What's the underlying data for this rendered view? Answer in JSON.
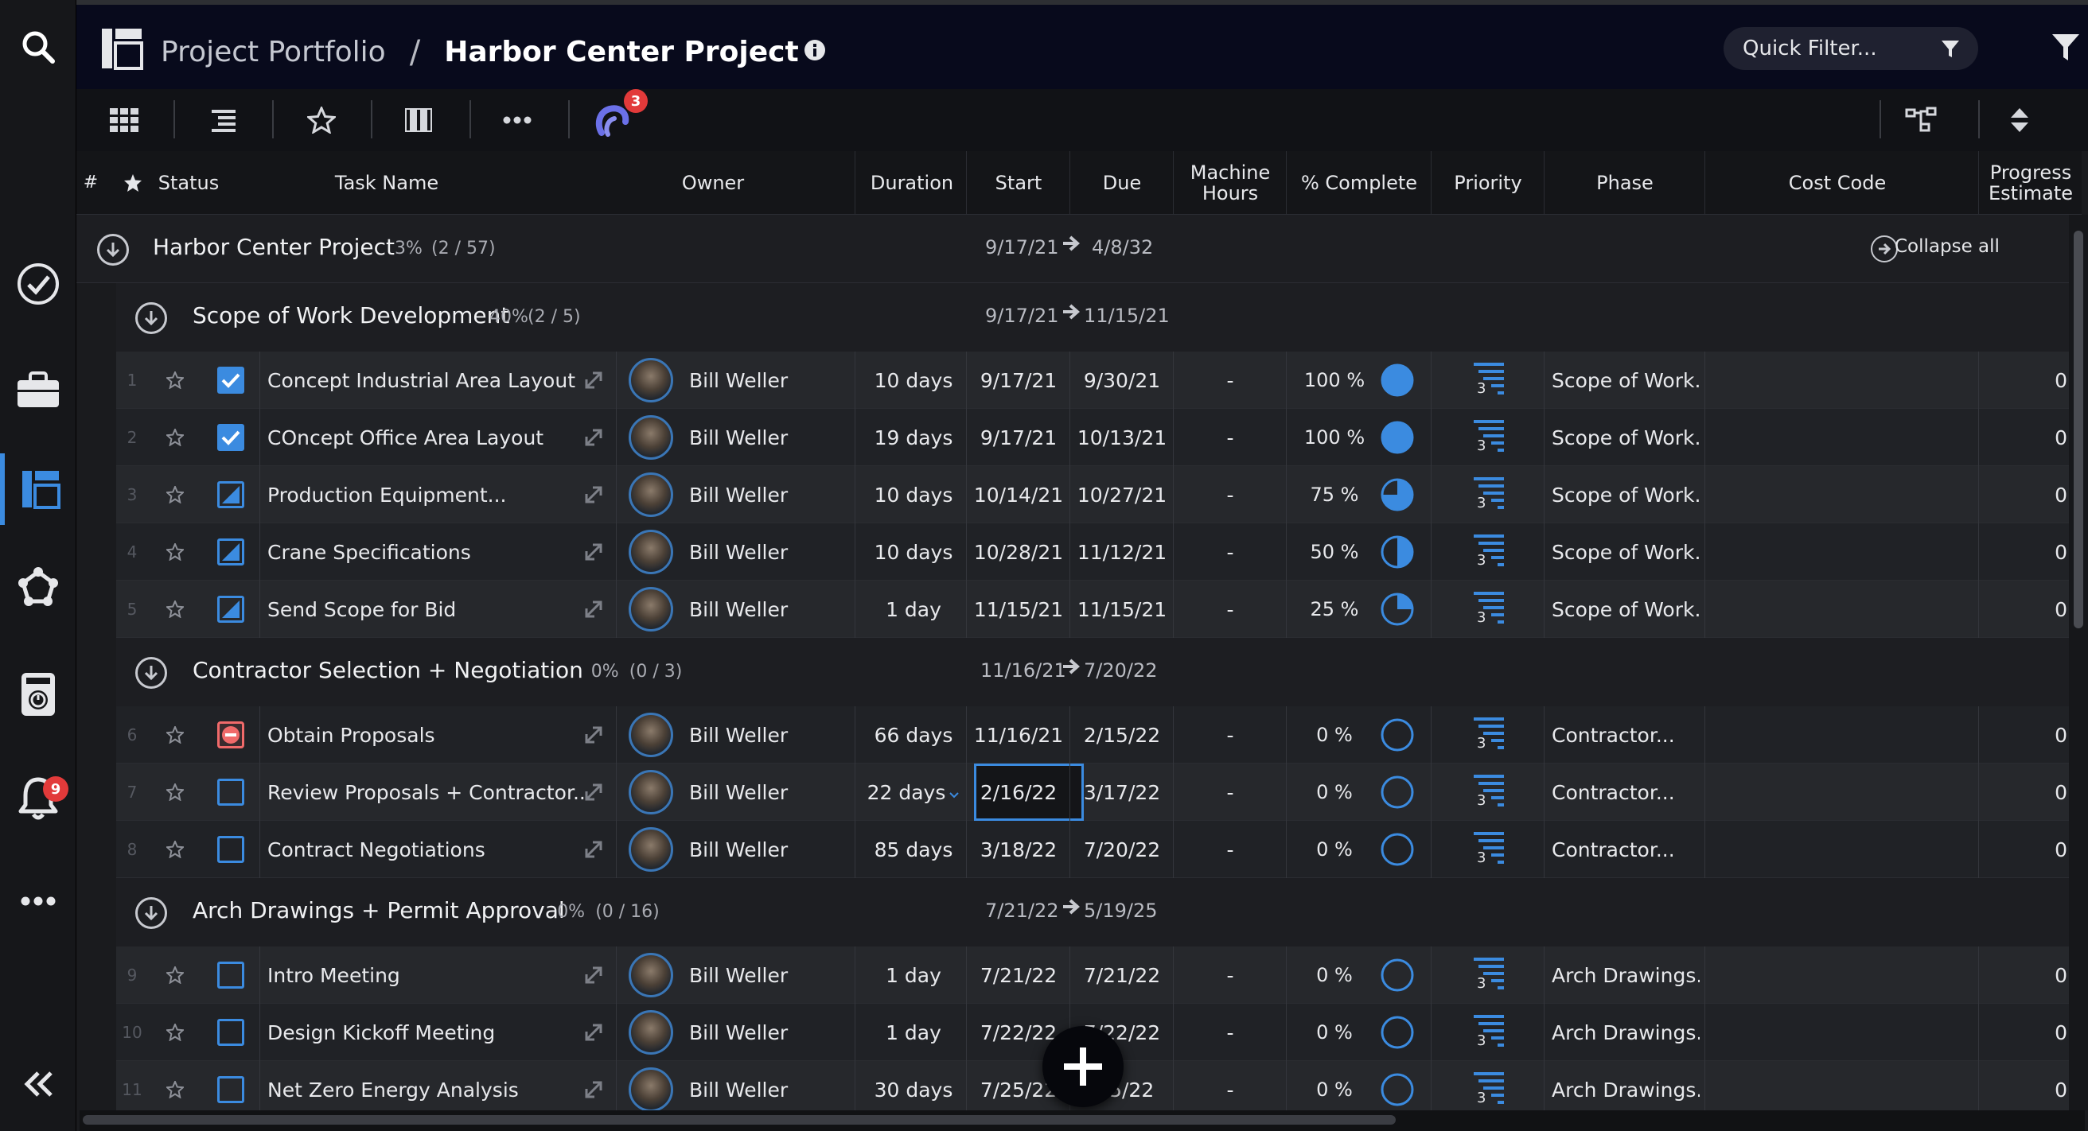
{
  "breadcrumb": {
    "portfolio": "Project Portfolio",
    "separator": "/",
    "project": "Harbor Center Project"
  },
  "quick_filter": {
    "placeholder": "Quick Filter..."
  },
  "toolbar": {
    "comments_badge": "3"
  },
  "sidebar": {
    "notifications_badge": "9"
  },
  "columns": [
    "#",
    "Status",
    "Task Name",
    "Owner",
    "Duration",
    "Start",
    "Due",
    "Machine Hours",
    "% Complete",
    "Priority",
    "Phase",
    "Cost Code",
    "Progress Estimate"
  ],
  "project_row": {
    "name": "Harbor Center Project",
    "pct": "3%",
    "count": "(2 / 57)",
    "start": "9/17/21",
    "due": "4/8/32",
    "collapse_label": "Collapse all"
  },
  "groups": [
    {
      "name": "Scope of Work Development",
      "pct": "40%",
      "count": "(2 / 5)",
      "start": "9/17/21",
      "due": "11/15/21"
    },
    {
      "name": "Contractor Selection + Negotiation",
      "pct": "0%",
      "count": "(0 / 3)",
      "start": "11/16/21",
      "due": "7/20/22"
    },
    {
      "name": "Arch Drawings + Permit Approval",
      "pct": "0%",
      "count": "(0 / 16)",
      "start": "7/21/22",
      "due": "5/19/25"
    }
  ],
  "tasks": [
    {
      "num": "1",
      "status": "complete",
      "name": "Concept Industrial Area Layout",
      "owner": "Bill Weller",
      "duration": "10 days",
      "start": "9/17/21",
      "due": "9/30/21",
      "machine_hours": "-",
      "pct": "100 %",
      "pct_value": 100,
      "priority": "3",
      "phase": "Scope of Work...",
      "estimate": "0"
    },
    {
      "num": "2",
      "status": "complete",
      "name": "COncept Office Area Layout",
      "owner": "Bill Weller",
      "duration": "19 days",
      "start": "9/17/21",
      "due": "10/13/21",
      "machine_hours": "-",
      "pct": "100 %",
      "pct_value": 100,
      "priority": "3",
      "phase": "Scope of Work...",
      "estimate": "0"
    },
    {
      "num": "3",
      "status": "in-progress",
      "name": "Production Equipment...",
      "owner": "Bill Weller",
      "duration": "10 days",
      "start": "10/14/21",
      "due": "10/27/21",
      "machine_hours": "-",
      "pct": "75 %",
      "pct_value": 75,
      "priority": "3",
      "phase": "Scope of Work...",
      "estimate": "0"
    },
    {
      "num": "4",
      "status": "in-progress",
      "name": "Crane Specifications",
      "owner": "Bill Weller",
      "duration": "10 days",
      "start": "10/28/21",
      "due": "11/12/21",
      "machine_hours": "-",
      "pct": "50 %",
      "pct_value": 50,
      "priority": "3",
      "phase": "Scope of Work...",
      "estimate": "0"
    },
    {
      "num": "5",
      "status": "in-progress",
      "name": "Send Scope for Bid",
      "owner": "Bill Weller",
      "duration": "1 day",
      "start": "11/15/21",
      "due": "11/15/21",
      "machine_hours": "-",
      "pct": "25 %",
      "pct_value": 25,
      "priority": "3",
      "phase": "Scope of Work...",
      "estimate": "0"
    },
    {
      "num": "6",
      "status": "blocked",
      "name": "Obtain Proposals",
      "owner": "Bill Weller",
      "duration": "66 days",
      "start": "11/16/21",
      "due": "2/15/22",
      "machine_hours": "-",
      "pct": "0 %",
      "pct_value": 0,
      "priority": "3",
      "phase": "Contractor...",
      "estimate": "0"
    },
    {
      "num": "7",
      "status": "not-started",
      "name": "Review Proposals + Contractor...",
      "owner": "Bill Weller",
      "duration": "22 days",
      "start": "2/16/22",
      "due": "3/17/22",
      "machine_hours": "-",
      "pct": "0 %",
      "pct_value": 0,
      "priority": "3",
      "phase": "Contractor...",
      "estimate": "0"
    },
    {
      "num": "8",
      "status": "not-started",
      "name": "Contract Negotiations",
      "owner": "Bill Weller",
      "duration": "85 days",
      "start": "3/18/22",
      "due": "7/20/22",
      "machine_hours": "-",
      "pct": "0 %",
      "pct_value": 0,
      "priority": "3",
      "phase": "Contractor...",
      "estimate": "0"
    },
    {
      "num": "9",
      "status": "not-started",
      "name": "Intro Meeting",
      "owner": "Bill Weller",
      "duration": "1 day",
      "start": "7/21/22",
      "due": "7/21/22",
      "machine_hours": "-",
      "pct": "0 %",
      "pct_value": 0,
      "priority": "3",
      "phase": "Arch Drawings...",
      "estimate": "0"
    },
    {
      "num": "10",
      "status": "not-started",
      "name": "Design Kickoff Meeting",
      "owner": "Bill Weller",
      "duration": "1 day",
      "start": "7/22/22",
      "due": "7/22/22",
      "machine_hours": "-",
      "pct": "0 %",
      "pct_value": 0,
      "priority": "3",
      "phase": "Arch Drawings...",
      "estimate": "0"
    },
    {
      "num": "11",
      "status": "not-started",
      "name": "Net Zero Energy Analysis",
      "owner": "Bill Weller",
      "duration": "30 days",
      "start": "7/25/22",
      "due": "8/5/22",
      "machine_hours": "-",
      "pct": "0 %",
      "pct_value": 0,
      "priority": "3",
      "phase": "Arch Drawings...",
      "estimate": "0"
    }
  ],
  "colors": {
    "accent": "#3b8be0",
    "topbar": "#080a1c",
    "danger": "#e23a3a"
  }
}
